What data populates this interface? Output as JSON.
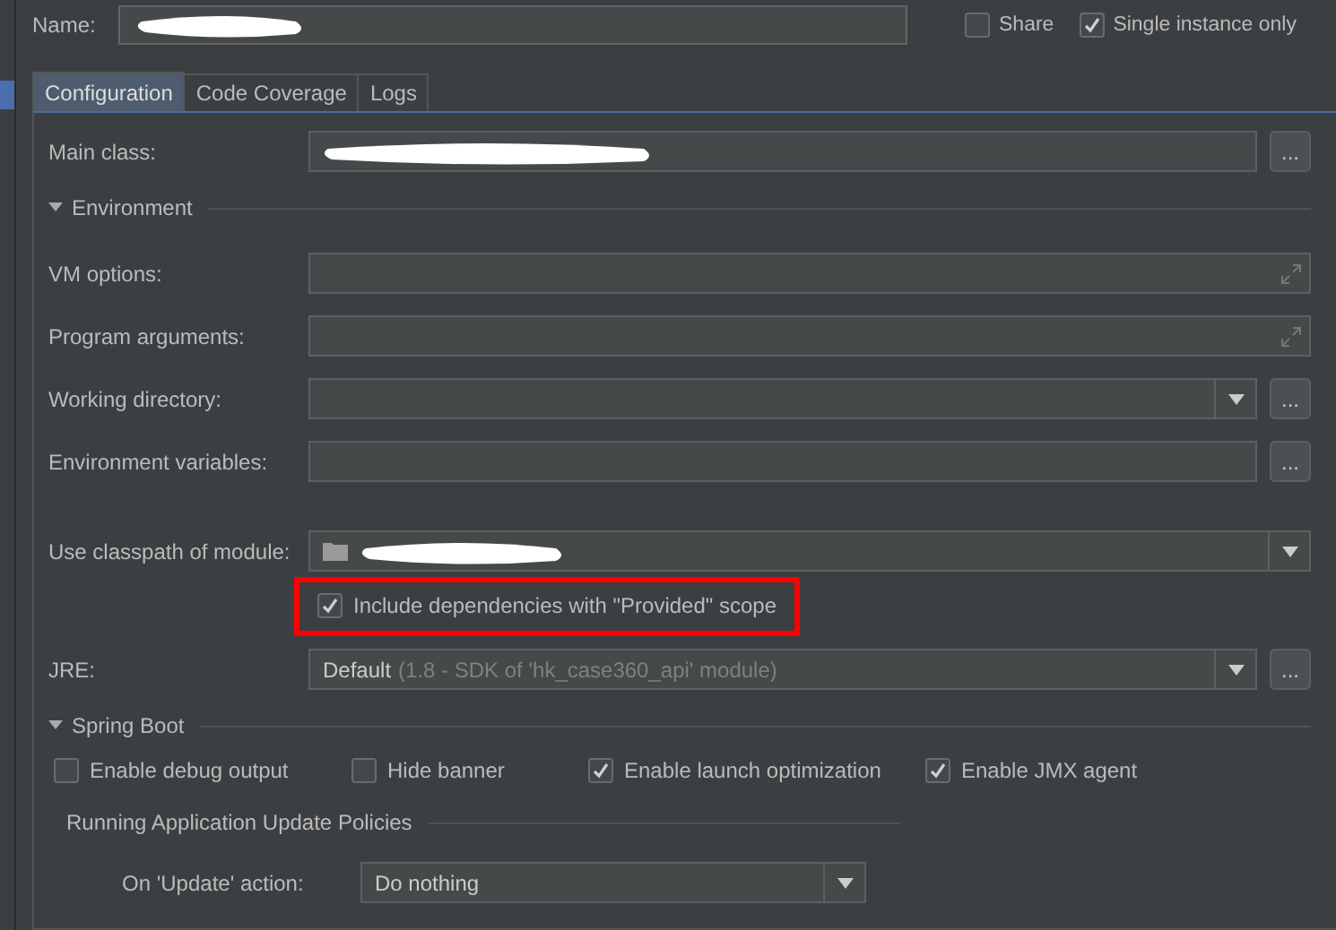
{
  "name_field": {
    "label": "Name:",
    "redacted": true
  },
  "share": {
    "label": "Share",
    "checked": false
  },
  "single_instance": {
    "label": "Single instance only",
    "checked": true
  },
  "tabs": [
    {
      "label": "Configuration",
      "selected": true
    },
    {
      "label": "Code Coverage",
      "selected": false
    },
    {
      "label": "Logs",
      "selected": false
    }
  ],
  "main_class": {
    "kind": "browse",
    "label": "Main class:",
    "redacted": true,
    "browse_label": "..."
  },
  "environment": {
    "title": "Environment",
    "expanded": true,
    "fields": [
      {
        "kind": "expandable",
        "label": "VM options:"
      },
      {
        "kind": "expandable",
        "label": "Program arguments:"
      },
      {
        "kind": "combo_browse",
        "label": "Working directory:",
        "browse_label": "..."
      },
      {
        "kind": "browse",
        "label": "Environment variables:",
        "browse_label": "..."
      }
    ]
  },
  "module": {
    "label": "Use classpath of module:",
    "redacted": true
  },
  "include_provided": {
    "label": "Include dependencies with \"Provided\" scope",
    "checked": true,
    "highlighted": true
  },
  "jre": {
    "label": "JRE:",
    "browse_label": "...",
    "value": "Default",
    "detail": "(1.8 - SDK of 'hk_case360_api' module)"
  },
  "spring_boot": {
    "title": "Spring Boot",
    "expanded": true,
    "options": [
      {
        "label": "Enable debug output",
        "checked": false
      },
      {
        "label": "Hide banner",
        "checked": false
      },
      {
        "label": "Enable launch optimization",
        "checked": true
      },
      {
        "label": "Enable JMX agent",
        "checked": true
      }
    ],
    "policies": {
      "title": "Running Application Update Policies",
      "update_action": {
        "label": "On 'Update' action:",
        "value": "Do nothing"
      }
    }
  }
}
